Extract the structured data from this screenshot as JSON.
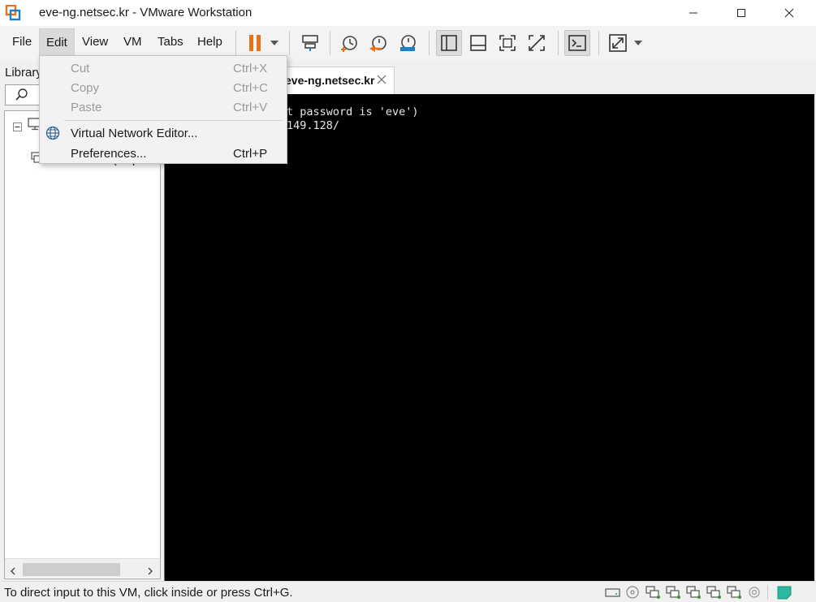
{
  "window": {
    "title": "eve-ng.netsec.kr - VMware Workstation"
  },
  "menubar": {
    "items": [
      "File",
      "Edit",
      "View",
      "VM",
      "Tabs",
      "Help"
    ],
    "active": "Edit"
  },
  "edit_menu": {
    "items": [
      {
        "label": "Cut",
        "shortcut": "Ctrl+X",
        "enabled": false
      },
      {
        "label": "Copy",
        "shortcut": "Ctrl+C",
        "enabled": false
      },
      {
        "label": "Paste",
        "shortcut": "Ctrl+V",
        "enabled": false
      },
      {
        "label": "Virtual Network Editor...",
        "shortcut": "",
        "enabled": true,
        "icon": "globe-icon"
      },
      {
        "label": "Preferences...",
        "shortcut": "Ctrl+P",
        "enabled": true
      }
    ]
  },
  "library": {
    "title": "Library",
    "tree_label_partial": "Shared VMs (Depre"
  },
  "tabs": {
    "active_label": "eve-ng.netsec.kr"
  },
  "console": {
    "lines": [
      "t password is 'eve')",
      "149.128/"
    ]
  },
  "statusbar": {
    "text": "To direct input to this VM, click inside or press Ctrl+G."
  },
  "colors": {
    "accent_orange": "#e8711c",
    "accent_blue": "#1f7ec4",
    "console_bg": "#000000"
  }
}
